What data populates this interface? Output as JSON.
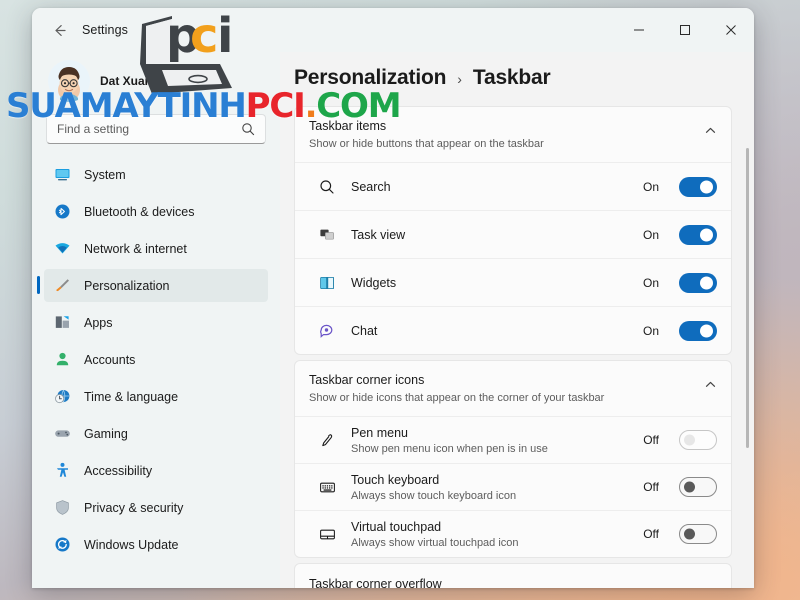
{
  "window": {
    "app_title": "Settings",
    "back_icon": "back-arrow-icon",
    "controls": {
      "minimize": "minimize-icon",
      "maximize": "maximize-icon",
      "close": "close-icon"
    }
  },
  "account": {
    "name": "Dat Xuan",
    "avatar": "user-avatar"
  },
  "search": {
    "placeholder": "Find a setting",
    "value": "",
    "icon": "search-icon"
  },
  "sidebar": {
    "items": [
      {
        "label": "System",
        "icon": "system-monitor-icon",
        "active": false
      },
      {
        "label": "Bluetooth & devices",
        "icon": "bluetooth-icon",
        "active": false
      },
      {
        "label": "Network & internet",
        "icon": "wifi-icon",
        "active": false
      },
      {
        "label": "Personalization",
        "icon": "paintbrush-icon",
        "active": true
      },
      {
        "label": "Apps",
        "icon": "apps-icon",
        "active": false
      },
      {
        "label": "Accounts",
        "icon": "account-person-icon",
        "active": false
      },
      {
        "label": "Time & language",
        "icon": "clock-globe-icon",
        "active": false
      },
      {
        "label": "Gaming",
        "icon": "gamepad-icon",
        "active": false
      },
      {
        "label": "Accessibility",
        "icon": "accessibility-person-icon",
        "active": false
      },
      {
        "label": "Privacy & security",
        "icon": "shield-icon",
        "active": false
      },
      {
        "label": "Windows Update",
        "icon": "update-refresh-icon",
        "active": false
      }
    ]
  },
  "breadcrumb": {
    "parent": "Personalization",
    "separator": "›",
    "current": "Taskbar"
  },
  "sections": [
    {
      "title": "Taskbar items",
      "subtitle": "Show or hide buttons that appear on the taskbar",
      "chevron": "chevron-up-icon",
      "rows": [
        {
          "title": "Search",
          "subtitle": "",
          "icon": "search-icon",
          "state": "On",
          "on": true,
          "highlighted": false
        },
        {
          "title": "Task view",
          "subtitle": "",
          "icon": "task-view-icon",
          "state": "On",
          "on": true,
          "highlighted": false
        },
        {
          "title": "Widgets",
          "subtitle": "",
          "icon": "widgets-icon",
          "state": "On",
          "on": true,
          "highlighted": false
        },
        {
          "title": "Chat",
          "subtitle": "",
          "icon": "chat-bubble-icon",
          "state": "On",
          "on": true,
          "highlighted": true
        }
      ]
    },
    {
      "title": "Taskbar corner icons",
      "subtitle": "Show or hide icons that appear on the corner of your taskbar",
      "chevron": "chevron-up-icon",
      "rows": [
        {
          "title": "Pen menu",
          "subtitle": "Show pen menu icon when pen is in use",
          "icon": "pen-icon",
          "state": "Off",
          "on": false,
          "highlighted": false
        },
        {
          "title": "Touch keyboard",
          "subtitle": "Always show touch keyboard icon",
          "icon": "keyboard-icon",
          "state": "Off",
          "on": false,
          "highlighted": false
        },
        {
          "title": "Virtual touchpad",
          "subtitle": "Always show virtual touchpad icon",
          "icon": "touchpad-icon",
          "state": "Off",
          "on": false,
          "highlighted": false
        }
      ]
    }
  ],
  "tail_section": {
    "title": "Taskbar corner overflow"
  },
  "annotations": {
    "highlight_box_color": "#d81212",
    "arrow_color": "#f00b0b",
    "arrow_target": "chat-toggle"
  },
  "watermark": {
    "logo_text_1": "p",
    "logo_text_2": "c",
    "logo_text_3": "i",
    "site_part_1": "SUAMAYTINH",
    "site_part_2": "PCI",
    "site_part_3": ".",
    "site_part_4": "COM",
    "colors": {
      "blue": "#2a7fd4",
      "red": "#e8252b",
      "orange": "#f07d1c",
      "green": "#1ea64a"
    }
  }
}
